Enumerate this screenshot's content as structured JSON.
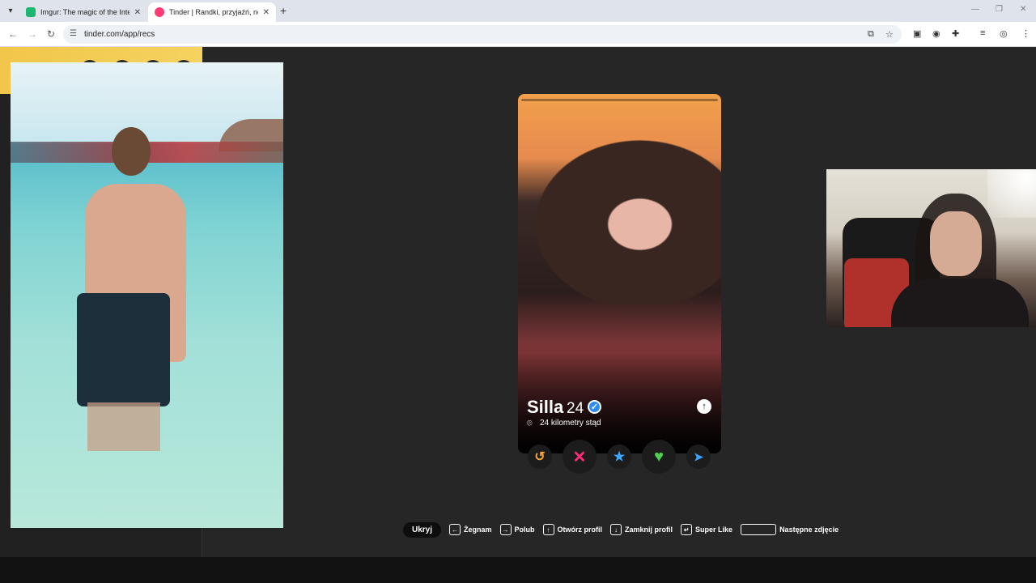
{
  "browser": {
    "tabs": [
      {
        "title": "Imgur: The magic of the Interne",
        "active": false,
        "favicon_color": "#1bb76e"
      },
      {
        "title": "Tinder | Randki, przyjaźń, nowe",
        "active": true,
        "favicon_color": "#fd3d73"
      }
    ],
    "new_tab_label": "+",
    "url": "tinder.com/app/recs"
  },
  "profile": {
    "name": "Silla",
    "age": "24",
    "distance": "24 kilometry stąd",
    "verified_icon": "✓",
    "open_profile_icon": "↑"
  },
  "actions": {
    "rewind_icon": "↺",
    "nope_icon": "✕",
    "superlike_icon": "★",
    "like_icon": "♥",
    "boost_icon": "➤"
  },
  "hints": {
    "hide_label": "Ukryj",
    "items": [
      {
        "key": "←",
        "label": "Żegnam"
      },
      {
        "key": "→",
        "label": "Polub"
      },
      {
        "key": "↑",
        "label": "Otwórz profil"
      },
      {
        "key": "↓",
        "label": "Zamknij profil"
      },
      {
        "key": "↵",
        "label": "Super Like"
      },
      {
        "key": "",
        "label": "Następne zdjęcie"
      }
    ]
  },
  "colors": {
    "nope": "#ff2d78",
    "like": "#4ed04e",
    "superlike": "#3aa8ff",
    "rewind": "#f4a43a"
  }
}
